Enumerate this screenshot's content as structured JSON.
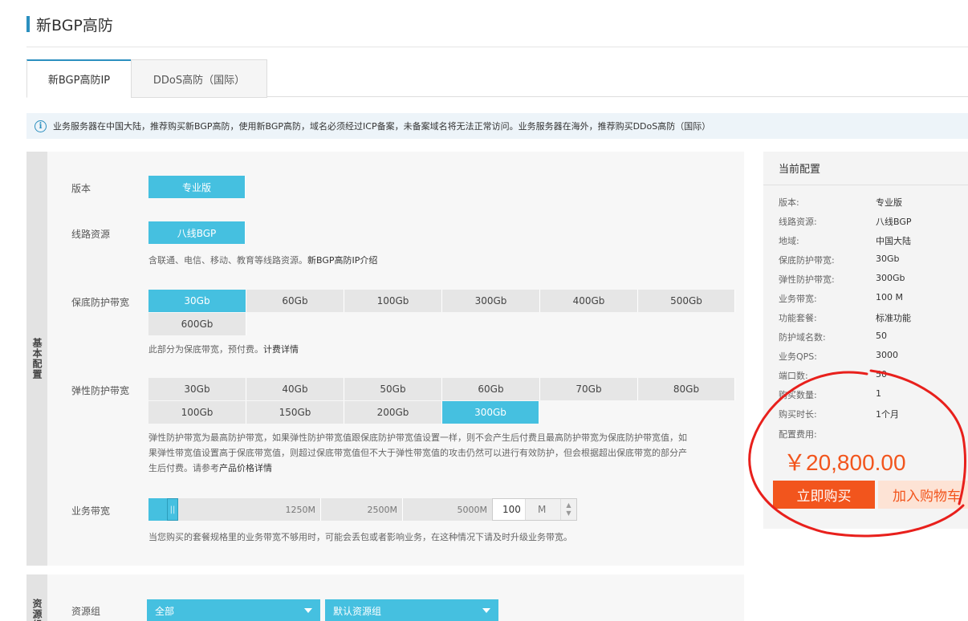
{
  "page_title": "新BGP高防",
  "tabs": [
    {
      "label": "新BGP高防IP",
      "active": true
    },
    {
      "label": "DDoS高防（国际）",
      "active": false
    }
  ],
  "notice": "业务服务器在中国大陆，推荐购买新BGP高防，使用新BGP高防，域名必须经过ICP备案，未备案域名将无法正常访问。业务服务器在海外，推荐购买DDoS高防（国际）",
  "section_basic": "基本配置",
  "section_resource": "资源组",
  "form": {
    "edition": {
      "label": "版本",
      "options": [
        "专业版"
      ],
      "selected": "专业版"
    },
    "line": {
      "label": "线路资源",
      "options": [
        "八线BGP"
      ],
      "selected": "八线BGP",
      "hint": "含联通、电信、移动、教育等线路资源。",
      "hint_link": "新BGP高防IP介绍"
    },
    "base_bw": {
      "label": "保底防护带宽",
      "options": [
        "30Gb",
        "60Gb",
        "100Gb",
        "300Gb",
        "400Gb",
        "500Gb",
        "600Gb"
      ],
      "selected": "30Gb",
      "hint": "此部分为保底带宽，预付费。",
      "hint_link": "计费详情"
    },
    "elastic_bw": {
      "label": "弹性防护带宽",
      "options": [
        "30Gb",
        "40Gb",
        "50Gb",
        "60Gb",
        "70Gb",
        "80Gb",
        "100Gb",
        "150Gb",
        "200Gb",
        "300Gb"
      ],
      "selected": "300Gb",
      "hint_line1": "弹性防护带宽为最高防护带宽，如果弹性防护带宽值跟保底防护带宽值设置一样，则不会产生后付费且最高防护带宽为保底防护带宽值，如",
      "hint_line2": "果弹性带宽值设置高于保底带宽值，则超过保底带宽值但不大于弹性带宽值的攻击仍然可以进行有效防护，但会根据超出保底带宽的部分产",
      "hint_line3": "生后付费。请参考",
      "hint_link": "产品价格详情"
    },
    "service_bw": {
      "label": "业务带宽",
      "ticks": [
        "1250M",
        "2500M",
        "5000M"
      ],
      "value": "100",
      "unit": "M",
      "hint": "当您购买的套餐规格里的业务带宽不够用时，可能会丢包或者影响业务，在这种情况下请及时升级业务带宽。"
    },
    "resource_group": {
      "label": "资源组",
      "dd1": "全部",
      "dd2": "默认资源组"
    }
  },
  "summary": {
    "title": "当前配置",
    "rows": [
      {
        "k": "版本:",
        "v": "专业版"
      },
      {
        "k": "线路资源:",
        "v": "八线BGP"
      },
      {
        "k": "地域:",
        "v": "中国大陆"
      },
      {
        "k": "保底防护带宽:",
        "v": "30Gb"
      },
      {
        "k": "弹性防护带宽:",
        "v": "300Gb"
      },
      {
        "k": "业务带宽:",
        "v": "100 M"
      },
      {
        "k": "功能套餐:",
        "v": "标准功能"
      },
      {
        "k": "防护域名数:",
        "v": "50"
      },
      {
        "k": "业务QPS:",
        "v": "3000"
      },
      {
        "k": "端口数:",
        "v": "50"
      },
      {
        "k": "购买数量:",
        "v": "1"
      },
      {
        "k": "购买时长:",
        "v": "1个月"
      }
    ],
    "fee_label": "配置费用:",
    "price": "￥20,800.00",
    "buy": "立即购买",
    "cart": "加入购物车"
  },
  "colors": {
    "accent": "#45c0e0",
    "price": "#f2551d",
    "annotation": "#e8201c"
  }
}
